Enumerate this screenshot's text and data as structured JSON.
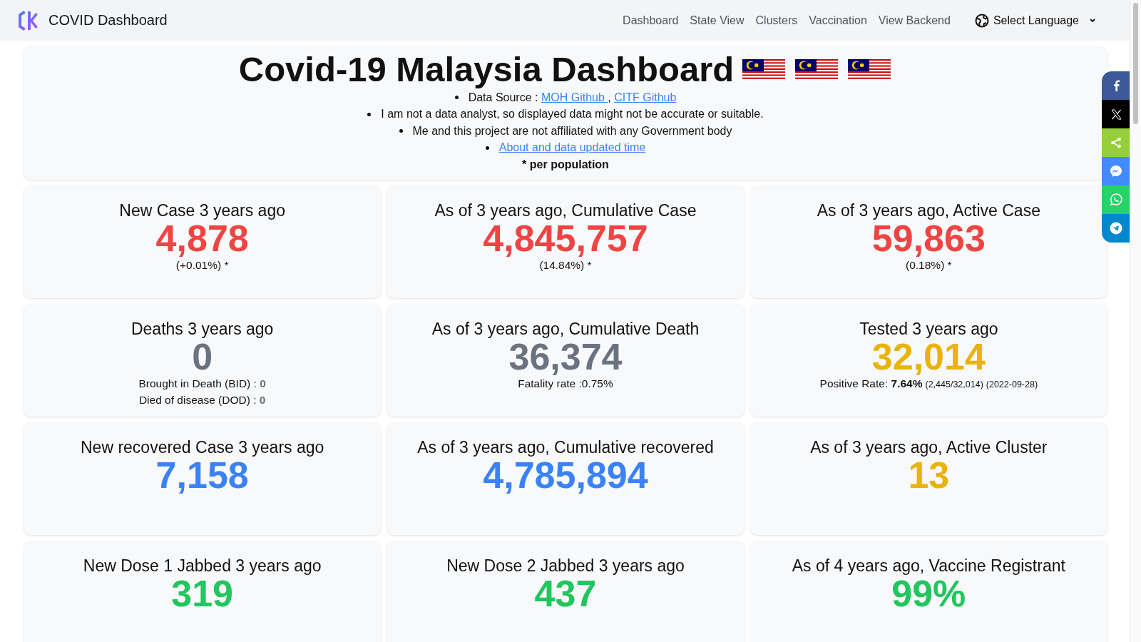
{
  "navbar": {
    "brand": "COVID Dashboard",
    "links": [
      {
        "label": "Dashboard"
      },
      {
        "label": "State View"
      },
      {
        "label": "Clusters"
      },
      {
        "label": "Vaccination"
      },
      {
        "label": "View Backend"
      }
    ],
    "language": "Select Language"
  },
  "header": {
    "title": "Covid-19 Malaysia Dashboard",
    "notes": [
      [
        {
          "kind": "text",
          "text": "Data Source : "
        },
        {
          "kind": "link",
          "text": "MOH Github ",
          "after": ","
        },
        {
          "kind": "link",
          "text": "CITF Github"
        }
      ],
      [
        {
          "kind": "text",
          "text": "I am not a data analyst, so displayed data might not be accurate or suitable."
        }
      ],
      [
        {
          "kind": "text",
          "text": "Me and this project are not affiliated with any Government body"
        }
      ],
      [
        {
          "kind": "link",
          "text": "About and data updated time"
        }
      ]
    ],
    "footnote": "* per population"
  },
  "cards": [
    {
      "title": "New Case 3 years ago",
      "value": "4,878",
      "color": "#ef4444",
      "lines": [
        {
          "text": "(+0.01%) *"
        }
      ]
    },
    {
      "title": "As of 3 years ago, Cumulative Case",
      "value": "4,845,757",
      "color": "#ef4444",
      "lines": [
        {
          "text": "(14.84%) *"
        }
      ]
    },
    {
      "title": "As of 3 years ago, Active Case",
      "value": "59,863",
      "color": "#ef4444",
      "lines": [
        {
          "text": "(0.18%) *"
        }
      ]
    },
    {
      "title": "Deaths 3 years ago",
      "value": "0",
      "color": "#6b7280",
      "lines": [
        {
          "text": "Brought in Death (BID) : **0**"
        },
        {
          "text": "Died of disease (DOD) : **0**"
        }
      ]
    },
    {
      "title": "As of 3 years ago, Cumulative Death",
      "value": "36,374",
      "color": "#6b7280",
      "lines": [
        {
          "text": "Fatality rate :0.75%"
        }
      ]
    },
    {
      "title": "Tested 3 years ago",
      "value": "32,014",
      "color": "#eab308",
      "lines": [
        {
          "text": "Positive Rate: **7.64%**",
          "notes": [
            "(2,445/32,014)",
            "(2022-09-28)"
          ]
        }
      ]
    },
    {
      "title": "New recovered Case 3 years ago",
      "value": "7,158",
      "color": "#3b82f6"
    },
    {
      "title": "As of 3 years ago, Cumulative recovered",
      "value": "4,785,894",
      "color": "#3b82f6"
    },
    {
      "title": "As of 3 years ago, Active Cluster",
      "value": "13",
      "color": "#eab308"
    },
    {
      "title": "New Dose 1 Jabbed 3 years ago",
      "value": "319",
      "color": "#22c55e"
    },
    {
      "title": "New Dose 2 Jabbed 3 years ago",
      "value": "437",
      "color": "#22c55e"
    },
    {
      "title": "As of 4 years ago, Vaccine Registrant",
      "value": "99%",
      "color": "#22c55e"
    }
  ],
  "share": [
    {
      "kind": "facebook",
      "color": "#3b5998"
    },
    {
      "kind": "x",
      "color": "#000000"
    },
    {
      "kind": "share",
      "color": "#95d03a"
    },
    {
      "kind": "messenger",
      "color": "#448aff"
    },
    {
      "kind": "whatsapp",
      "color": "#25d366"
    },
    {
      "kind": "telegram",
      "color": "#0088cc"
    }
  ]
}
